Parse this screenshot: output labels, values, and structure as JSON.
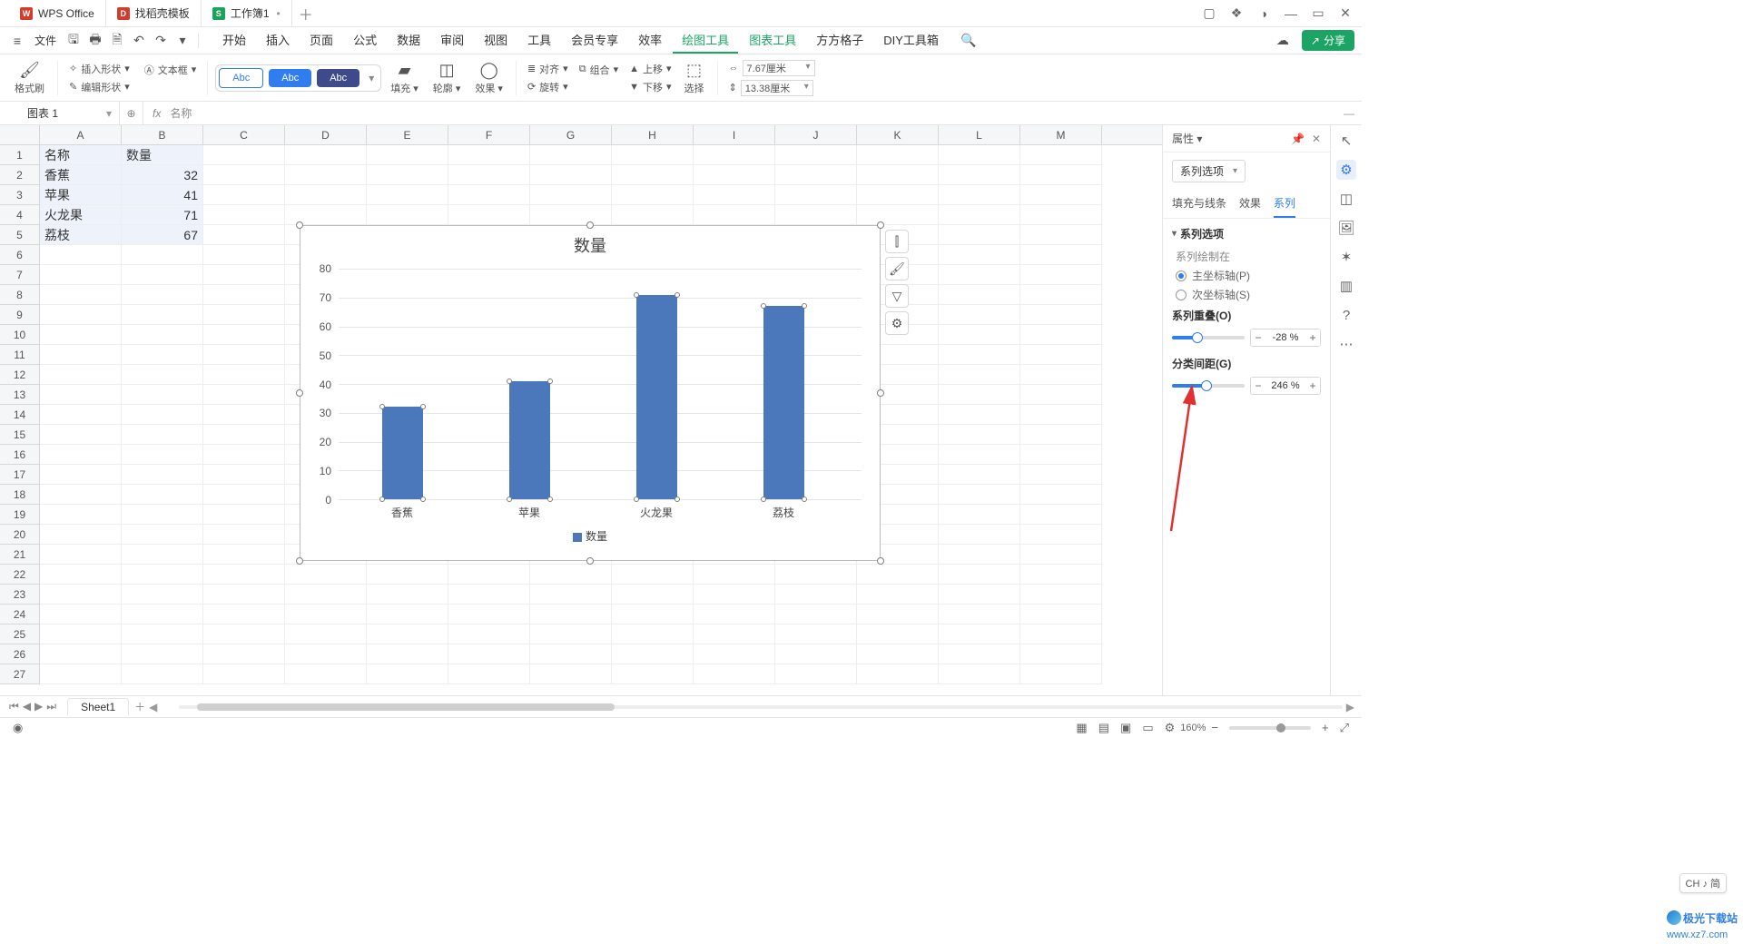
{
  "title_tabs": [
    {
      "icon": "W",
      "icon_class": "red",
      "label": "WPS Office"
    },
    {
      "icon": "D",
      "icon_class": "red",
      "label": "找稻壳模板"
    },
    {
      "icon": "S",
      "icon_class": "green",
      "label": "工作簿1",
      "active": true,
      "dirty": "•"
    }
  ],
  "file_menu": "文件",
  "main_menu": [
    "开始",
    "插入",
    "页面",
    "公式",
    "数据",
    "审阅",
    "视图",
    "工具",
    "会员专享",
    "效率",
    "绘图工具",
    "图表工具",
    "方方格子",
    "DIY工具箱"
  ],
  "active_menu": "绘图工具",
  "share_label": "分享",
  "ribbon": {
    "format_brush": "格式刷",
    "insert_shape": "插入形状",
    "text_box": "文本框",
    "edit_shape": "编辑形状",
    "chips": [
      "Abc",
      "Abc",
      "Abc"
    ],
    "fill": "填充",
    "outline": "轮廓",
    "effect": "效果",
    "align": "对齐",
    "group": "组合",
    "rotate": "旋转",
    "up": "上移",
    "down": "下移",
    "select": "选择",
    "width": "7.67厘米",
    "height": "13.38厘米"
  },
  "namebox": "图表 1",
  "fx_content": "名称",
  "columns": [
    "A",
    "B",
    "C",
    "D",
    "E",
    "F",
    "G",
    "H",
    "I",
    "J",
    "K",
    "L",
    "M"
  ],
  "rows": 27,
  "cells": {
    "A1": "名称",
    "B1": "数量",
    "A2": "香蕉",
    "B2": "32",
    "A3": "苹果",
    "B3": "41",
    "A4": "火龙果",
    "B4": "71",
    "A5": "荔枝",
    "B5": "67"
  },
  "chart_data": {
    "type": "bar",
    "title": "数量",
    "categories": [
      "香蕉",
      "苹果",
      "火龙果",
      "荔枝"
    ],
    "values": [
      32,
      41,
      71,
      67
    ],
    "ylim": [
      0,
      80
    ],
    "ystep": 10,
    "legend": "数量"
  },
  "chart_tools": [
    "⫿",
    "🖌",
    "⧩",
    "⚙"
  ],
  "panel": {
    "title": "属性",
    "series_options_btn": "系列选项",
    "subtabs": [
      "填充与线条",
      "效果",
      "系列"
    ],
    "active_subtab": "系列",
    "section_title": "系列选项",
    "series_on": "系列绘制在",
    "radio_primary": "主坐标轴(P)",
    "radio_secondary": "次坐标轴(S)",
    "overlap_label": "系列重叠(O)",
    "overlap_value": "-28",
    "overlap_pct": "%",
    "overlap_fill": 35,
    "gap_label": "分类间距(G)",
    "gap_value": "246",
    "gap_pct": "%",
    "gap_fill": 48
  },
  "sheet_tab": "Sheet1",
  "status_zoom": "160%",
  "ch_badge": "CH ♪ 简",
  "site": {
    "name": "极光下载站",
    "url": "www.xz7.com"
  }
}
